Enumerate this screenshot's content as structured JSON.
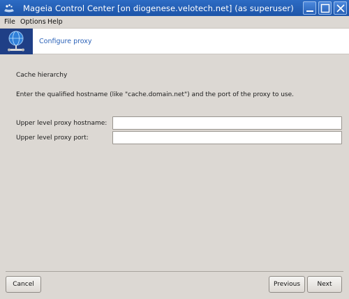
{
  "window": {
    "title": "Mageia Control Center  [on diogenese.velotech.net] (as superuser)",
    "icons": {
      "app": "mageia-icon",
      "minimize": "minimize-icon",
      "maximize": "maximize-icon",
      "close": "close-icon"
    },
    "colors": {
      "titlebar": "#1d55a8",
      "accent": "#2b62b8"
    }
  },
  "menu": {
    "items": [
      "File",
      "Options",
      "Help"
    ]
  },
  "banner": {
    "title": "Configure proxy",
    "icon": "globe-network-icon"
  },
  "content": {
    "heading": "Cache hierarchy",
    "instruction": "Enter the qualified hostname (like \"cache.domain.net\") and the port of the proxy to use.",
    "fields": [
      {
        "label": "Upper level proxy hostname:",
        "value": "",
        "placeholder": ""
      },
      {
        "label": "Upper level proxy port:",
        "value": "",
        "placeholder": ""
      }
    ]
  },
  "buttons": {
    "cancel": "Cancel",
    "previous": "Previous",
    "next": "Next"
  }
}
